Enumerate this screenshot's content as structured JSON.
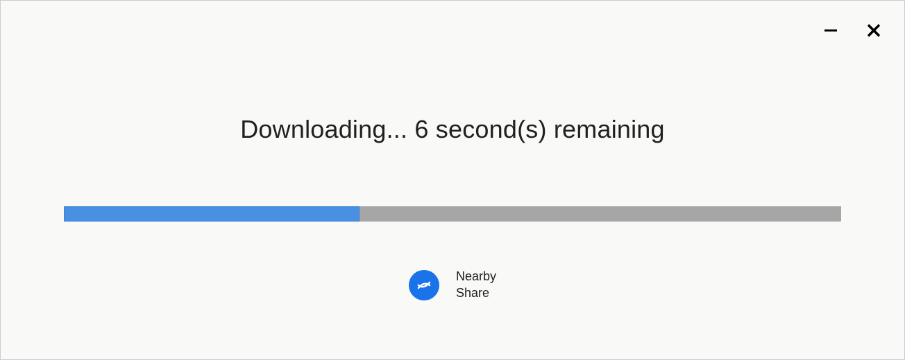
{
  "status": {
    "text": "Downloading... 6 second(s) remaining"
  },
  "progress": {
    "percent": 38
  },
  "nearby": {
    "line1": "Nearby",
    "line2": "Share"
  },
  "colors": {
    "accent": "#1a73e8",
    "progress_fill": "#4a90e2",
    "progress_track": "#a6a6a6"
  }
}
